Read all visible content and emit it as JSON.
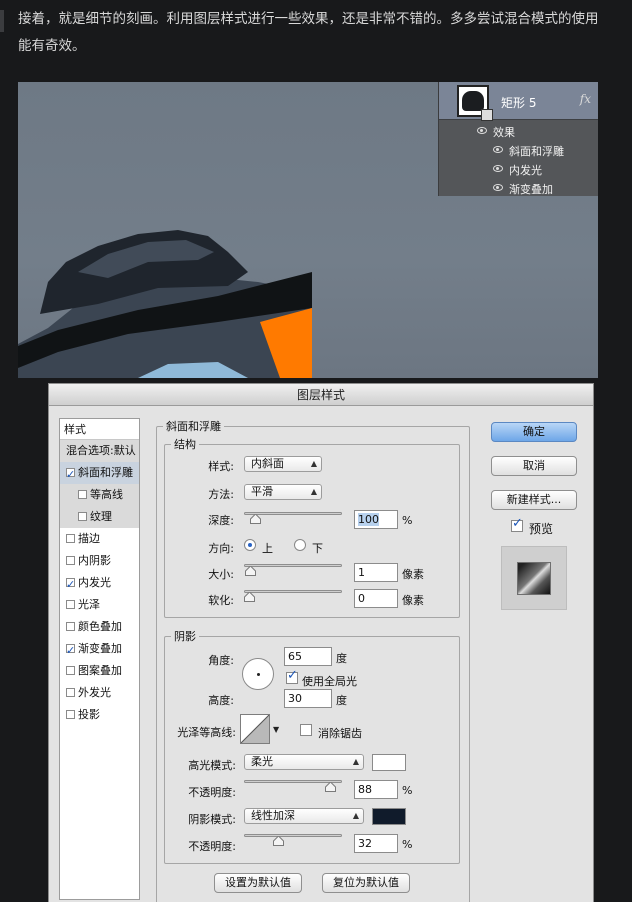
{
  "article": {
    "line1": "接着，就是细节的刻画。利用图层样式进行一些效果，还是非常不错的。多多尝试混合模式的使用",
    "line2": "能有奇效。"
  },
  "layers_panel": {
    "layer_name": "矩形 5",
    "fx": "fx",
    "effects_label": "效果",
    "effects": [
      "斜面和浮雕",
      "内发光",
      "渐变叠加"
    ]
  },
  "dialog": {
    "title": "图层样式",
    "style_list": {
      "header": "样式",
      "blend_options": "混合选项:默认",
      "items": [
        {
          "label": "斜面和浮雕",
          "checked": true,
          "selected": true
        },
        {
          "label": "等高线",
          "checked": false,
          "sub": true
        },
        {
          "label": "纹理",
          "checked": false,
          "sub": true
        },
        {
          "label": "描边",
          "checked": false
        },
        {
          "label": "内阴影",
          "checked": false
        },
        {
          "label": "内发光",
          "checked": true
        },
        {
          "label": "光泽",
          "checked": false
        },
        {
          "label": "颜色叠加",
          "checked": false
        },
        {
          "label": "渐变叠加",
          "checked": true
        },
        {
          "label": "图案叠加",
          "checked": false
        },
        {
          "label": "外发光",
          "checked": false
        },
        {
          "label": "投影",
          "checked": false
        }
      ]
    },
    "bevel": {
      "group_title": "斜面和浮雕",
      "structure_title": "结构",
      "style_label": "样式:",
      "style_value": "内斜面",
      "technique_label": "方法:",
      "technique_value": "平滑",
      "depth_label": "深度:",
      "depth_value": "100",
      "depth_unit": "%",
      "direction_label": "方向:",
      "direction_up": "上",
      "direction_down": "下",
      "size_label": "大小:",
      "size_value": "1",
      "size_unit": "像素",
      "soften_label": "软化:",
      "soften_value": "0",
      "soften_unit": "像素"
    },
    "shading": {
      "title": "阴影",
      "angle_label": "角度:",
      "angle_value": "65",
      "angle_unit": "度",
      "global_light_label": "使用全局光",
      "global_light_checked": true,
      "altitude_label": "高度:",
      "altitude_value": "30",
      "altitude_unit": "度",
      "gloss_contour_label": "光泽等高线:",
      "anti_alias_label": "消除锯齿",
      "highlight_mode_label": "高光模式:",
      "highlight_mode_value": "柔光",
      "highlight_color": "#ffffff",
      "highlight_opacity_label": "不透明度:",
      "highlight_opacity_value": "88",
      "highlight_opacity_unit": "%",
      "shadow_mode_label": "阴影模式:",
      "shadow_mode_value": "线性加深",
      "shadow_color": "#101b2b",
      "shadow_opacity_label": "不透明度:",
      "shadow_opacity_value": "32",
      "shadow_opacity_unit": "%"
    },
    "buttons": {
      "make_default": "设置为默认值",
      "reset_default": "复位为默认值",
      "ok": "确定",
      "cancel": "取消",
      "new_style": "新建样式...",
      "preview": "预览"
    },
    "slider_levels": {
      "depth": 0.07,
      "size": 0.01,
      "soften": 0.0,
      "highlight_opacity": 0.88,
      "shadow_opacity": 0.32
    }
  }
}
